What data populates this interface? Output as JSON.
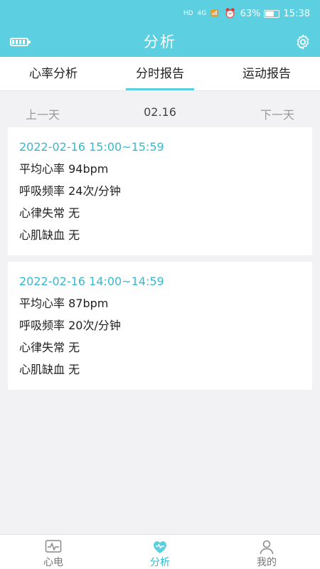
{
  "status_bar": {
    "signal1": "HD",
    "signal2": "HD",
    "network": "4G",
    "battery_percent": "63%",
    "time": "15:38"
  },
  "header": {
    "title": "分析"
  },
  "tabs": [
    {
      "label": "心率分析"
    },
    {
      "label": "分时报告",
      "active": true
    },
    {
      "label": "运动报告"
    }
  ],
  "day_nav": {
    "prev": "上一天",
    "date": "02.16",
    "next": "下一天"
  },
  "reports": [
    {
      "time_range": "2022-02-16 15:00~15:59",
      "avg_hr": "平均心率 94bpm",
      "resp_rate": "呼吸频率 24次/分钟",
      "arrhythmia": "心律失常 无",
      "ischemia": "心肌缺血 无"
    },
    {
      "time_range": "2022-02-16 14:00~14:59",
      "avg_hr": "平均心率 87bpm",
      "resp_rate": "呼吸频率 20次/分钟",
      "arrhythmia": "心律失常 无",
      "ischemia": "心肌缺血 无"
    }
  ],
  "bottom_nav": [
    {
      "label": "心电",
      "icon": "ecg-icon"
    },
    {
      "label": "分析",
      "icon": "heart-icon",
      "active": true
    },
    {
      "label": "我的",
      "icon": "user-icon"
    }
  ],
  "colors": {
    "accent": "#5ccfe0",
    "accent_text": "#36b9cf"
  }
}
